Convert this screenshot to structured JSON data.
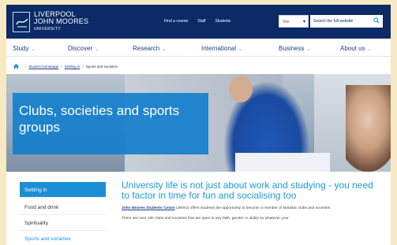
{
  "header": {
    "logo_line1": "LIVERPOOL",
    "logo_line2": "JOHN MOORES",
    "logo_line3": "UNIVERSITY",
    "links": [
      "Find a course",
      "Staff",
      "Students"
    ],
    "site_select": "Site",
    "search_placeholder": "Search the full website",
    "colors": {
      "navy": "#0b2a66",
      "accent_blue": "#1b8fd6"
    }
  },
  "nav": {
    "items": [
      "Study",
      "Discover",
      "Research",
      "International",
      "Business",
      "About us"
    ]
  },
  "breadcrumb": {
    "items": [
      "Student homepage",
      "Settling in",
      "Sports and societies"
    ]
  },
  "hero": {
    "title": "Clubs, societies and sports groups"
  },
  "sidebar": {
    "items": [
      "Settling in",
      "Food and drink",
      "Spirituality",
      "Sports and societies"
    ]
  },
  "content": {
    "heading": "University life is not just about work and studying - you need to factor in time for fun and socialising too",
    "para1_link": "John Moores Students' Union",
    "para1_rest": " (JMSU) offers students the opportunity to become a member of fantastic clubs and societies.",
    "para2": "There are over 180 clubs and societies that are open to any faith, gender or ability so whatever your"
  }
}
